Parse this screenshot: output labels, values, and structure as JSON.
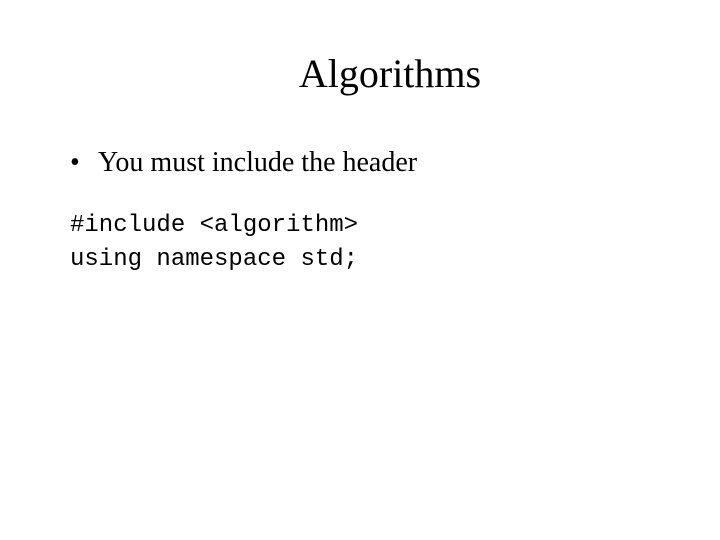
{
  "title": "Algorithms",
  "bullets": [
    "You must include the header"
  ],
  "code": {
    "line1": "#include <algorithm>",
    "line2": "using namespace std;"
  }
}
